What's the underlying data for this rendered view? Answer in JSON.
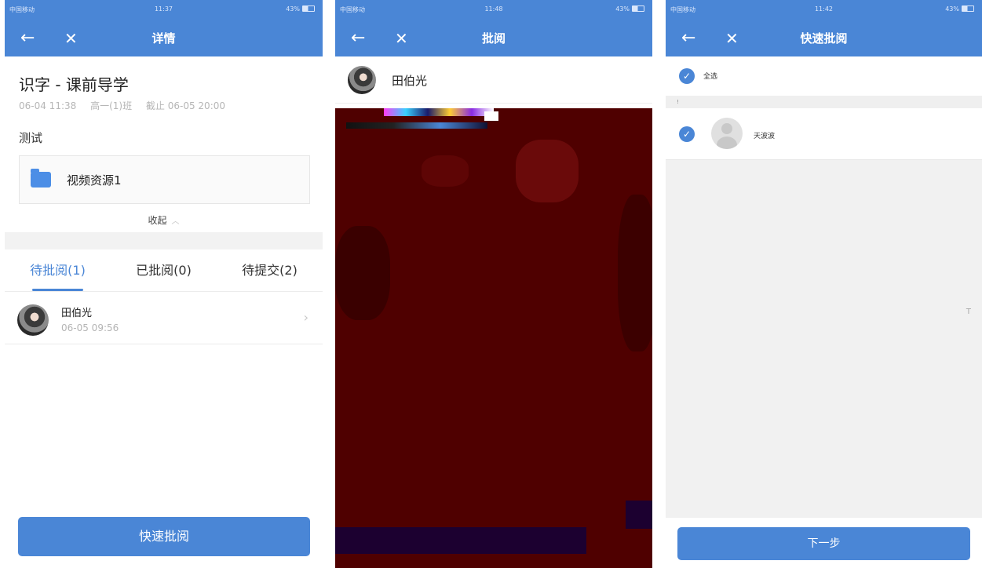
{
  "status": {
    "carrier": "中国移动",
    "battery": "43%",
    "times": [
      "11:37",
      "11:48",
      "11:42"
    ]
  },
  "detail": {
    "title": "详情",
    "lesson_title": "识字 - 课前导学",
    "meta": [
      "06-04 11:38",
      "高一(1)班",
      "截止 06-05 20:00"
    ],
    "section_label": "测试",
    "resource_name": "视频资源1",
    "collapse_label": "收起",
    "tabs": [
      "待批阅(1)",
      "已批阅(0)",
      "待提交(2)"
    ],
    "student_name": "田伯光",
    "student_time": "06-05 09:56",
    "button": "快速批阅"
  },
  "review": {
    "title": "批阅",
    "student_name": "田伯光"
  },
  "quick": {
    "title": "快速批阅",
    "select_all": "全选",
    "group_marker": "!",
    "student_name": "天波波",
    "side_marker": "T",
    "button": "下一步"
  },
  "colors": {
    "accent": "#4a86d6",
    "canvas": "#4f0000"
  },
  "icons": [
    "back-arrow-icon",
    "close-icon",
    "folder-icon",
    "chevron-up-icon",
    "chevron-right-icon",
    "check-icon",
    "default-avatar-icon"
  ]
}
